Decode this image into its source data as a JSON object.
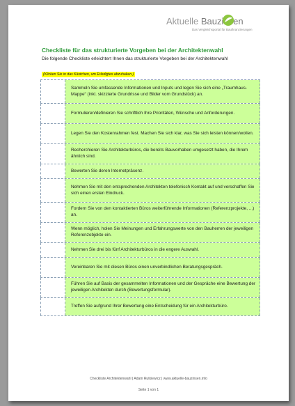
{
  "logo": {
    "brand_part1": "Aktuelle ",
    "brand_part2": "Bauzinsen",
    "tagline": "Das Vergleichsportal für Baufinanzierungen",
    "icon": "leaf-circle-icon",
    "colors": {
      "green": "#8cc63f",
      "gray": "#9a9a9a"
    }
  },
  "document": {
    "title": "Checkliste für das strukturierte Vorgeben bei der Architektenwahl",
    "intro": "Die folgende Checkliste erleichtert Ihnen das strukturierte Vorgeben bei der Architektenwahl",
    "hint": "(Klicken Sie in das Kästchen, um Erledigtes abzuhaken.)"
  },
  "checklist": [
    {
      "text": "Sammeln Sie umfassende Informationen und Inputs und legen Sie sich eine „Traumhaus-Mappe“ (inkl. skizzierte Grundrisse und Bilder vom Grundstück) an.",
      "checked": false
    },
    {
      "text": "Formulieren/definieren Sie schriftlich Ihre Prioritäten, Wünsche und Anforderungen.",
      "checked": false
    },
    {
      "text": "Legen Sie den Kostenrahmen fest. Machen Sie sich klar, was Sie sich leisten können/wollen.",
      "checked": false
    },
    {
      "text": "Recherchieren Sie Architekturbüros, die bereits Bauvorhaben umgesetzt haben, die Ihrem ähnlich sind.",
      "checked": false
    },
    {
      "text": "Bewerten Sie deren Internetpräsenz.",
      "checked": false
    },
    {
      "text": "Nehmen Sie mit den entsprechenden Architekten telefonisch Kontakt auf und verschaffen Sie sich einen ersten Eindruck.",
      "checked": false
    },
    {
      "text": "Fordern Sie von den kontaktierten Büros weiterführende Informationen (Referenzprojekte, ...) an.",
      "checked": false
    },
    {
      "text": "Wenn möglich, holen Sie Meinungen und Erfahrungswerte von den Bauherren der jeweiligen Referenzobjekte ein.",
      "checked": false
    },
    {
      "text": "Nehmen Sie drei bis fünf Architekturbüros in die engere Auswahl.",
      "checked": false
    },
    {
      "text": "Vereinbaren Sie mit diesen Büros einen unverbindlichen Beratungsgespräch.",
      "checked": false
    },
    {
      "text": "Führen Sie auf Basis der gesammelten Informationen und der Gespräche eine Bewertung der jeweiligen Architekten durch (Bewertungsformular).",
      "checked": false
    },
    {
      "text": "Treffen Sie aufgrund Ihrer Bewertung eine Entscheidung für ein Architekturbüro.",
      "checked": false
    }
  ],
  "footer": {
    "line1": "Checkliste Architektenwahl | Adam Rutkiewicz | www.aktuelle-bauzinsen.info",
    "line2": "Seite 1 von 1"
  }
}
